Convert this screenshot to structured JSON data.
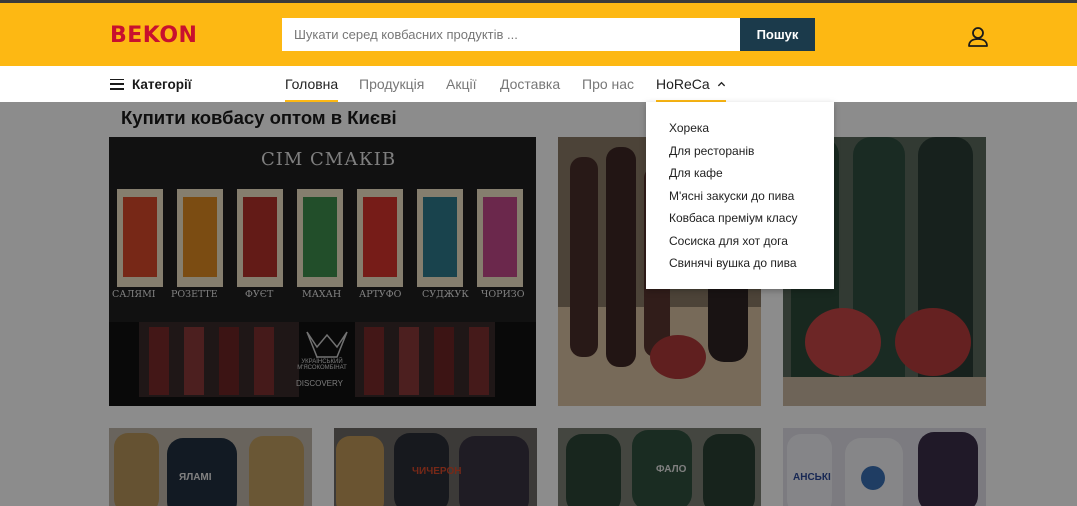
{
  "header": {
    "logo_text": "BEKON",
    "search_placeholder": "Шукати серед ковбасних продуктів ...",
    "search_value": "",
    "search_button_label": "Пошук"
  },
  "nav": {
    "categories_label": "Категорії",
    "links": [
      "Головна",
      "Продукція",
      "Акції",
      "Доставка",
      "Про нас",
      "HoReCa"
    ],
    "active": "Головна",
    "open_menu": "HoReCa"
  },
  "horeca_menu": {
    "items": [
      "Хорека",
      "Для ресторанів",
      "Для кафе",
      "М'ясні закуски до пива",
      "Ковбаса преміум класу",
      "Сосиска для хот дога",
      "Свинячі вушка до пива"
    ]
  },
  "main": {
    "title": "Купити ковбасу оптом в Києві",
    "featured_banner": {
      "heading": "СІМ СМАКІВ",
      "flavors": [
        "САЛЯМІ",
        "РОЗЕТТЕ",
        "ФУЄТ",
        "МАХАН",
        "АРТУФО",
        "СУДЖУК",
        "ЧОРИЗО"
      ],
      "brand_line_1": "УКРАЇНСЬКИЙ",
      "brand_line_2": "М'ЯСОКОМБІНАТ",
      "brand_line_3": "DISCOVERY"
    },
    "product_labels": {
      "tile_2": "ЯЛАМІ",
      "tile_4": "ЧИЧЕРОН",
      "tile_5": "ФАЛО",
      "tile_6": "АНСЬКІ"
    }
  },
  "colors": {
    "brand_yellow": "#fdb813",
    "logo_red": "#c8102e",
    "search_button": "#1b3a4b",
    "nav_active_underline": "#fdb813"
  },
  "icons": {
    "menu": "hamburger-icon",
    "user": "user-icon",
    "dropdown": "chevron-up-icon"
  }
}
